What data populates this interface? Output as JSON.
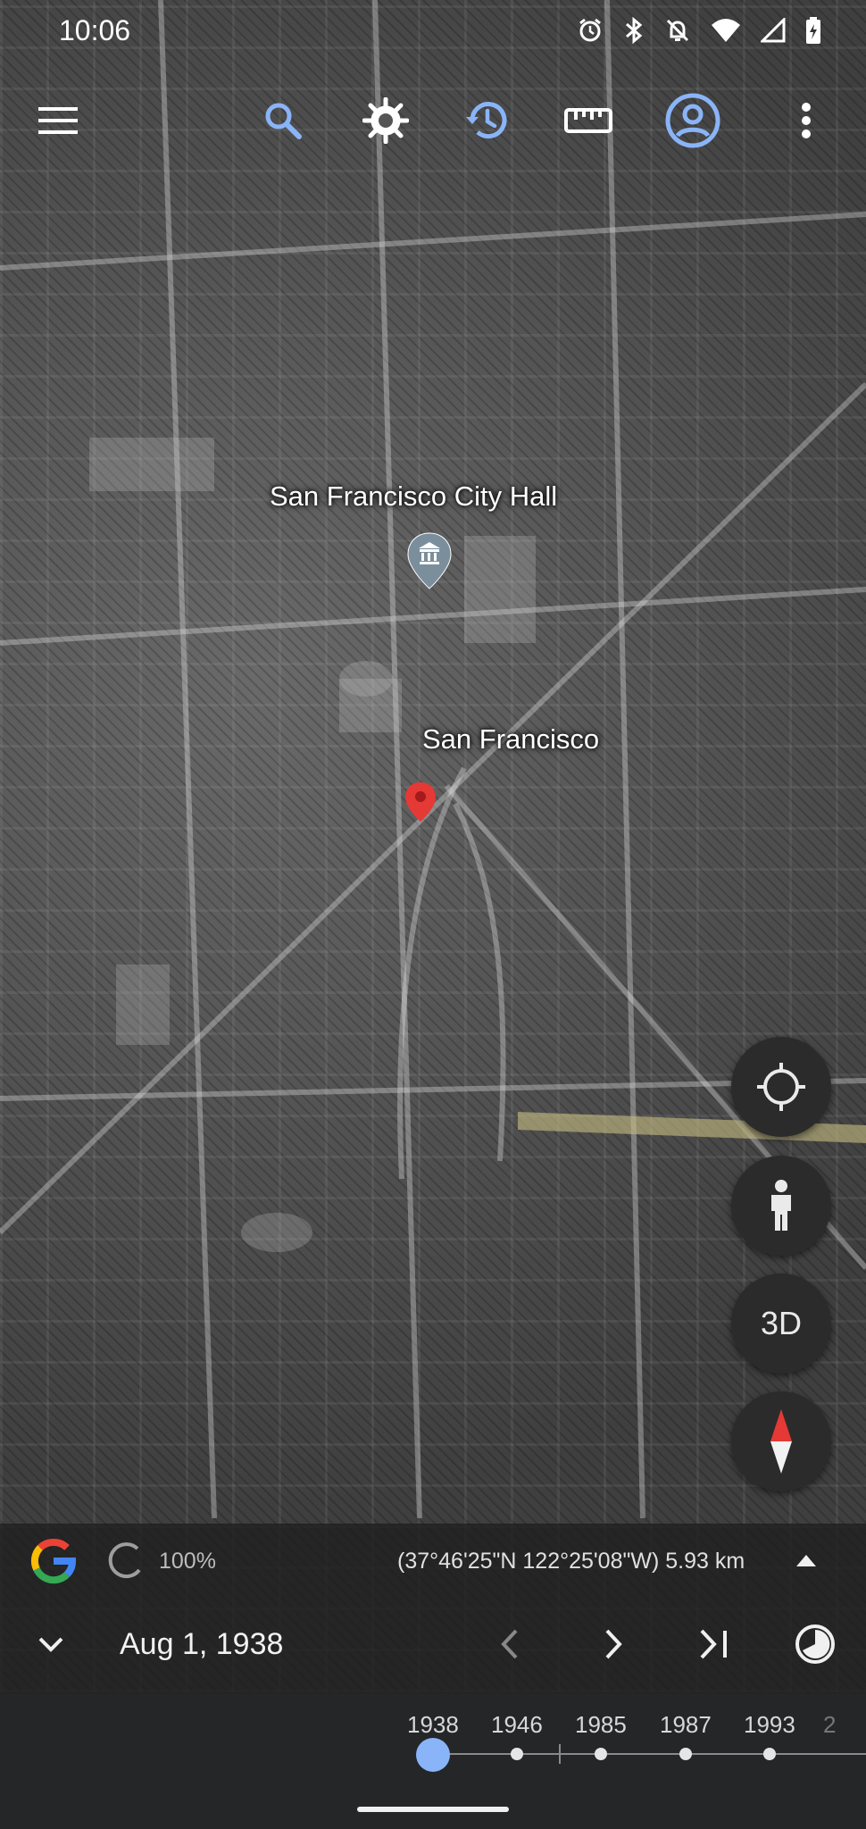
{
  "status_bar": {
    "time": "10:06",
    "icons": [
      "alarm-icon",
      "bluetooth-icon",
      "bell-off-icon",
      "wifi-icon",
      "signal-icon",
      "battery-icon"
    ]
  },
  "toolbar": {
    "icons": [
      "menu-icon",
      "search-icon",
      "voyager-wheel-icon",
      "history-icon",
      "ruler-icon",
      "account-icon",
      "more-vert-icon"
    ]
  },
  "map": {
    "labels": {
      "city_hall": "San Francisco City Hall",
      "city": "San Francisco"
    }
  },
  "fabs": {
    "locate_icon": "crosshair-icon",
    "street_view_icon": "pegman-icon",
    "mode_label": "3D",
    "compass_icon": "compass-icon"
  },
  "info_bar": {
    "loading_percent": "100%",
    "coordinates": "(37°46'25\"N 122°25'08\"W) 5.93 km",
    "date": "Aug 1, 1938"
  },
  "timeline": {
    "years": [
      "1938",
      "1946",
      "1985",
      "1987",
      "1993",
      "2"
    ],
    "selected_year": "1938"
  },
  "colors": {
    "accent_blue": "#8ab4f8",
    "marker_red": "#e53935",
    "fab_bg": "#2b2b2b",
    "panel_bg": "#242628"
  }
}
